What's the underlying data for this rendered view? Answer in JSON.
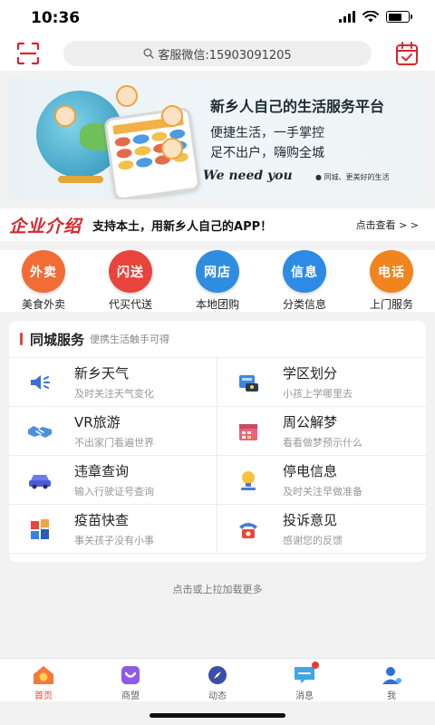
{
  "status": {
    "time": "10:36"
  },
  "search": {
    "text": "客服微信:15903091205"
  },
  "banner": {
    "title": "新乡人自己的生活服务平台",
    "line1": "便捷生活，一手掌控",
    "line2": "足不出户，嗨购全城",
    "slogan": "We need you",
    "slogan_sub": "● 同城、更美好的生活"
  },
  "intro": {
    "logo": "企业介绍",
    "text": "支持本土，用新乡人自己的APP！",
    "more": "点击查看 > >"
  },
  "quick_links": [
    {
      "badge": "外卖",
      "label": "美食外卖",
      "color": "#f26c35"
    },
    {
      "badge": "闪送",
      "label": "代买代送",
      "color": "#e8443c"
    },
    {
      "badge": "网店",
      "label": "本地团购",
      "color": "#2f8de0"
    },
    {
      "badge": "信息",
      "label": "分类信息",
      "color": "#2d8be6"
    },
    {
      "badge": "电话",
      "label": "上门服务",
      "color": "#f0851f"
    }
  ],
  "services": {
    "title": "同城服务",
    "subtitle": "便携生活触手可得",
    "items": [
      {
        "title": "新乡天气",
        "desc": "及时关注天气变化",
        "icon": "speaker-icon"
      },
      {
        "title": "学区划分",
        "desc": "小孩上学哪里去",
        "icon": "school-icon"
      },
      {
        "title": "VR旅游",
        "desc": "不出家门看遍世界",
        "icon": "handshake-icon"
      },
      {
        "title": "周公解梦",
        "desc": "看看做梦预示什么",
        "icon": "calendar-icon"
      },
      {
        "title": "违章查询",
        "desc": "输入行驶证号查询",
        "icon": "car-icon"
      },
      {
        "title": "停电信息",
        "desc": "及时关注早做准备",
        "icon": "bulb-icon"
      },
      {
        "title": "疫苗快查",
        "desc": "事关孩子没有小事",
        "icon": "blocks-icon"
      },
      {
        "title": "投诉意见",
        "desc": "感谢您的反馈",
        "icon": "phone-icon"
      }
    ]
  },
  "load_more": "点击或上拉加载更多",
  "tabs": [
    {
      "label": "首页",
      "active": true
    },
    {
      "label": "商盟",
      "active": false
    },
    {
      "label": "动态",
      "active": false
    },
    {
      "label": "消息",
      "active": false
    },
    {
      "label": "我",
      "active": false
    }
  ],
  "colors": {
    "accent": "#e34a3b",
    "brand_red": "#d8262d"
  }
}
